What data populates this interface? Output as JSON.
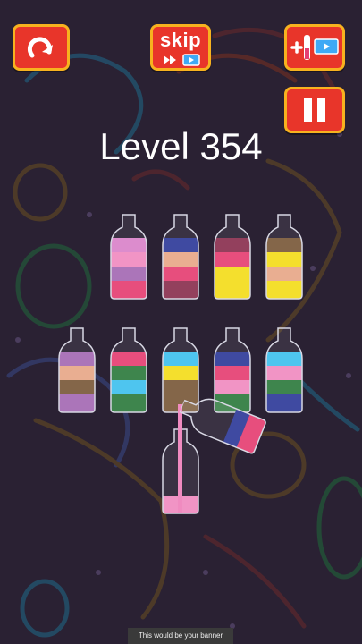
{
  "header": {
    "level_text": "Level 354",
    "skip_label": "skip"
  },
  "buttons": {
    "restart": {
      "icon": "restart-icon"
    },
    "skip": {
      "icon": "skip-video-icon"
    },
    "add_tube": {
      "icon": "add-tube-video-icon"
    },
    "pause": {
      "icon": "pause-icon"
    }
  },
  "colors": {
    "button_red": "#e8352a",
    "button_border": "#f7b21f",
    "background": "#2a2133"
  },
  "bottles": [
    {
      "id": 1,
      "layers": [
        "#d983c9",
        "#f08bc0",
        "#a46ab4",
        "#e53f72"
      ]
    },
    {
      "id": 2,
      "layers": [
        "#2f3b9a",
        "#e8a888",
        "#e53f72",
        "#8a3050"
      ]
    },
    {
      "id": 3,
      "layers": [
        "#8a3050",
        "#e53f72",
        "#f3dd1c",
        "#f3dd1c"
      ]
    },
    {
      "id": 4,
      "layers": [
        "#7a5a3a",
        "#f3dd1c",
        "#e8a888",
        "#f3dd1c"
      ]
    },
    {
      "id": 5,
      "layers": [
        "#a46ab4",
        "#e8a888",
        "#7a5a3a",
        "#a46ab4"
      ]
    },
    {
      "id": 6,
      "layers": [
        "#e53f72",
        "#2e7b3e",
        "#3fc0ee",
        "#2e7b3e"
      ]
    },
    {
      "id": 7,
      "layers": [
        "#3fc0ee",
        "#f3dd1c",
        "#7a5a3a",
        "#7a5a3a"
      ]
    },
    {
      "id": 8,
      "layers": [
        "#2f3b9a",
        "#e53f72",
        "#f08bc0",
        "#2e7b3e"
      ]
    },
    {
      "id": 9,
      "layers": [
        "#3fc0ee",
        "#f08bc0",
        "#2e7b3e",
        "#2f3b9a"
      ]
    },
    {
      "id": 10,
      "layers": [
        "#f08bc0"
      ],
      "state": "receiving"
    }
  ],
  "pouring_bottle": {
    "layers": [
      "#2f3b9a",
      "#e53f72"
    ],
    "state": "pouring"
  },
  "stream_color": "#f08bc0",
  "banner_text": "This would be your banner"
}
